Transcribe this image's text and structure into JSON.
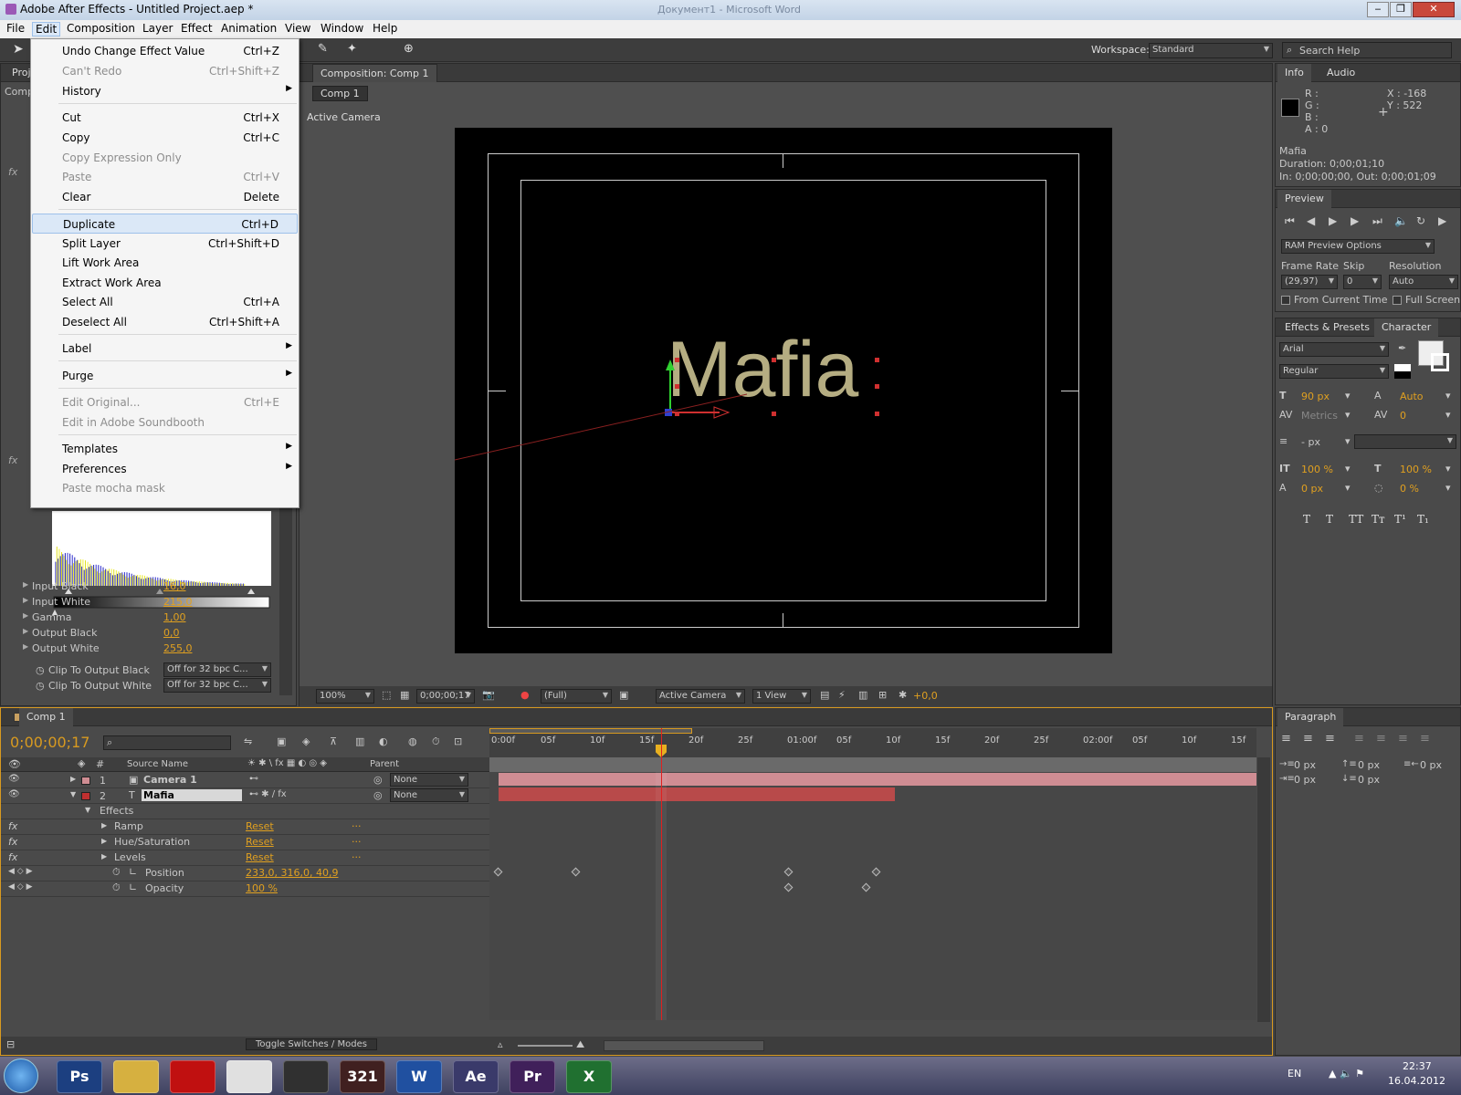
{
  "window": {
    "title": "Adobe After Effects - Untitled Project.aep *",
    "bg_title": "Документ1 - Microsoft Word"
  },
  "menubar": [
    "File",
    "Edit",
    "Composition",
    "Layer",
    "Effect",
    "Animation",
    "View",
    "Window",
    "Help"
  ],
  "editmenu": [
    {
      "label": "Undo Change Effect Value",
      "shortcut": "Ctrl+Z"
    },
    {
      "label": "Can't Redo",
      "shortcut": "Ctrl+Shift+Z",
      "disabled": true
    },
    {
      "label": "History",
      "submenu": true
    },
    {
      "label": "Cut",
      "shortcut": "Ctrl+X"
    },
    {
      "label": "Copy",
      "shortcut": "Ctrl+C"
    },
    {
      "label": "Copy Expression Only",
      "disabled": true
    },
    {
      "label": "Paste",
      "shortcut": "Ctrl+V",
      "disabled": true
    },
    {
      "label": "Clear",
      "shortcut": "Delete"
    },
    {
      "label": "Duplicate",
      "shortcut": "Ctrl+D",
      "highlight": true
    },
    {
      "label": "Split Layer",
      "shortcut": "Ctrl+Shift+D"
    },
    {
      "label": "Lift Work Area"
    },
    {
      "label": "Extract Work Area"
    },
    {
      "label": "Select All",
      "shortcut": "Ctrl+A"
    },
    {
      "label": "Deselect All",
      "shortcut": "Ctrl+Shift+A"
    },
    {
      "label": "Label",
      "submenu": true
    },
    {
      "label": "Purge",
      "submenu": true
    },
    {
      "label": "Edit Original...",
      "shortcut": "Ctrl+E",
      "disabled": true
    },
    {
      "label": "Edit in Adobe Soundbooth",
      "disabled": true
    },
    {
      "label": "Templates",
      "submenu": true
    },
    {
      "label": "Preferences",
      "submenu": true
    },
    {
      "label": "Paste mocha mask",
      "disabled": true
    }
  ],
  "toolbar": {
    "workspace_label": "Workspace:",
    "workspace_value": "Standard",
    "search_placeholder": "Search Help"
  },
  "left_panel": {
    "tab1": "Proj",
    "tab2": "Comp",
    "fx": "fx",
    "levels": [
      {
        "label": "Input Black",
        "value": "16,0"
      },
      {
        "label": "Input White",
        "value": "215,0"
      },
      {
        "label": "Gamma",
        "value": "1,00"
      },
      {
        "label": "Output Black",
        "value": "0,0"
      },
      {
        "label": "Output White",
        "value": "255,0"
      }
    ],
    "clip_black": {
      "label": "Clip To Output Black",
      "value": "Off for 32 bpc C..."
    },
    "clip_white": {
      "label": "Clip To Output White",
      "value": "Off for 32 bpc C..."
    }
  },
  "composition": {
    "tab": "Composition: Comp 1",
    "subtab": "Comp 1",
    "view_label": "Active Camera",
    "text": "Mafia",
    "footer": {
      "zoom": "100%",
      "time": "0;00;00;17",
      "quality": "(Full)",
      "camera": "Active Camera",
      "views": "1 View",
      "exposure": "+0,0"
    }
  },
  "info": {
    "tab1": "Info",
    "tab2": "Audio",
    "r": "R :",
    "g": "G :",
    "b": "B :",
    "a": "A : 0",
    "x": "X : -168",
    "y": "Y : 522",
    "name": "Mafia",
    "duration": "Duration: 0;00;01;10",
    "inout": "In: 0;00;00;00, Out: 0;00;01;09"
  },
  "preview": {
    "tab": "Preview",
    "ram": "RAM Preview Options",
    "frame_rate_label": "Frame Rate",
    "skip_label": "Skip",
    "resolution_label": "Resolution",
    "frame_rate": "(29,97)",
    "skip": "0",
    "resolution": "Auto",
    "from_current": "From Current Time",
    "full_screen": "Full Screen"
  },
  "character": {
    "tab1": "Effects & Presets",
    "tab2": "Character",
    "font": "Arial",
    "style": "Regular",
    "size": "90 px",
    "leading": "Auto",
    "kerning": "Metrics",
    "tracking": "0",
    "stroke": "- px",
    "vscale": "100 %",
    "hscale": "100 %",
    "baseline": "0 px",
    "tsume": "0 %",
    "styles": [
      "T",
      "T",
      "TT",
      "Tт",
      "T¹",
      "T₁"
    ]
  },
  "paragraph": {
    "tab": "Paragraph",
    "values": [
      "0 px",
      "0 px",
      "0 px",
      "0 px",
      "0 px"
    ]
  },
  "timeline": {
    "tab": "Comp 1",
    "timecode": "0;00;00;17",
    "headers": {
      "source": "Source Name",
      "parent": "Parent"
    },
    "ruler": [
      "0:00f",
      "05f",
      "10f",
      "15f",
      "20f",
      "25f",
      "01:00f",
      "05f",
      "10f",
      "15f",
      "20f",
      "25f",
      "02:00f",
      "05f",
      "10f",
      "15f"
    ],
    "layers": [
      {
        "num": "1",
        "name": "Camera 1",
        "parent": "None"
      },
      {
        "num": "2",
        "name": "Mafia",
        "parent": "None"
      }
    ],
    "effects_label": "Effects",
    "effects": [
      {
        "name": "Ramp",
        "reset": "Reset",
        "dots": "..."
      },
      {
        "name": "Hue/Saturation",
        "reset": "Reset",
        "dots": "..."
      },
      {
        "name": "Levels",
        "reset": "Reset",
        "dots": "..."
      }
    ],
    "position": {
      "label": "Position",
      "value": "233,0, 316,0, 40,9"
    },
    "opacity": {
      "label": "Opacity",
      "value": "100 %"
    },
    "toggle": "Toggle Switches / Modes"
  },
  "taskbar": {
    "apps": [
      "Ps",
      "",
      "",
      "",
      "",
      "321",
      "W",
      "Ae",
      "Pr",
      "X"
    ],
    "lang": "EN",
    "time": "22:37",
    "date": "16.04.2012"
  }
}
